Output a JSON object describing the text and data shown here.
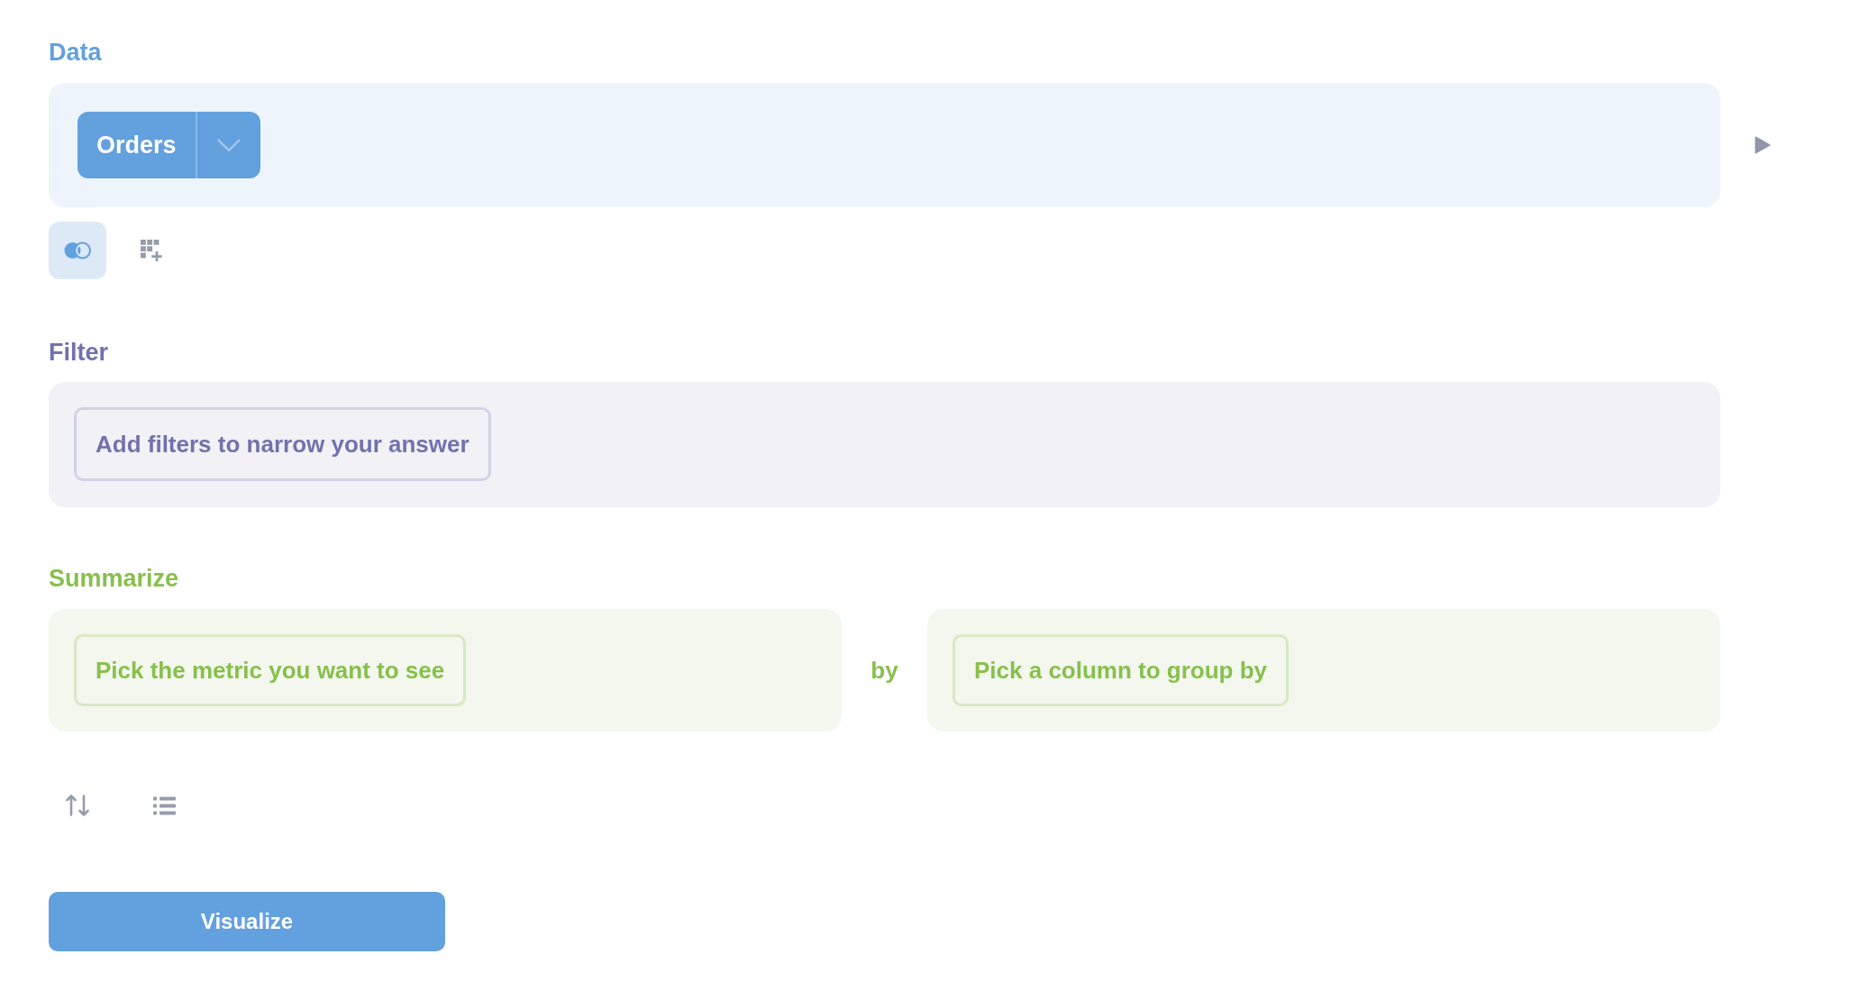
{
  "data": {
    "title": "Data",
    "table_button": {
      "label": "Orders"
    },
    "tools": [
      {
        "kind": "join"
      },
      {
        "kind": "custom_column"
      }
    ]
  },
  "filter": {
    "title": "Filter",
    "prompt": "Add filters to narrow your answer"
  },
  "summarize": {
    "title": "Summarize",
    "metric_prompt": "Pick the metric you want to see",
    "connector": "by",
    "group_prompt": "Pick a column to group by"
  },
  "actions": [
    {
      "kind": "sort"
    },
    {
      "kind": "limit"
    }
  ],
  "visualize_button": {
    "label": "Visualize"
  }
}
